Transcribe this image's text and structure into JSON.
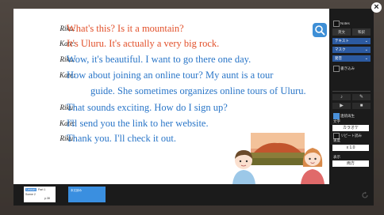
{
  "dialogue": [
    {
      "speaker": "Riku:",
      "text": "What's this?  Is it a mountain?",
      "color": "#e2502a"
    },
    {
      "speaker": "Kate:",
      "text": "It's Uluru.  It's actually a very big rock.",
      "color": "#e2502a"
    },
    {
      "speaker": "Riku:",
      "text": "Wow, it's beautiful.  I want to go there one day.",
      "color": "#2a76c8"
    },
    {
      "speaker": "Kate:",
      "text": "How about joining an online tour?  My aunt is a tour",
      "color": "#2a76c8"
    },
    {
      "speaker": "",
      "text": "guide.  She sometimes organizes online tours of Uluru.",
      "color": "#2a76c8"
    },
    {
      "speaker": "Riku:",
      "text": "That sounds exciting.  How do I sign up?",
      "color": "#2a76c8"
    },
    {
      "speaker": "Kate:",
      "text": "I'll send you the link to her website.",
      "color": "#2a76c8"
    },
    {
      "speaker": "Riku:",
      "text": "Thank you.  I'll check it out.",
      "color": "#2a76c8"
    }
  ],
  "panel": {
    "top_check": "Notes",
    "tabs": [
      "英文",
      "和訳"
    ],
    "selects": [
      "テキスト",
      "マスク",
      "発音"
    ],
    "write_check": "書き込み",
    "repeat_check": "連続再生",
    "label_1": "文字",
    "mode_value": "カラオケ",
    "repeat_read": "リピート読み",
    "label_2": "速度",
    "speed_value": "x 1.0",
    "label_3": "表示",
    "both_value": "両方"
  },
  "bottom": {
    "thumb1_badge": "Lesson 3",
    "thumb1_part": "Part 1",
    "thumb1_scene": "Scene 2",
    "thumb1_page": "p.38",
    "thumb2_label": "本文読み"
  },
  "close_label": "×"
}
